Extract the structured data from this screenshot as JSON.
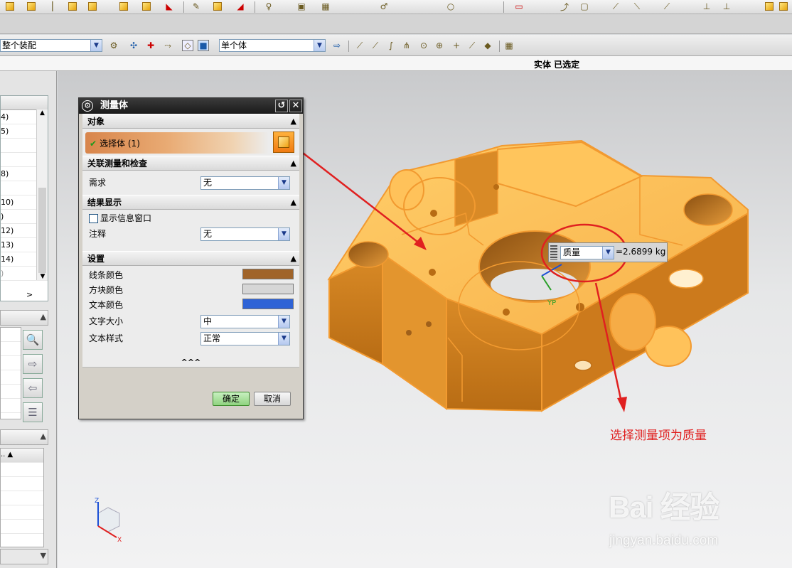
{
  "toolbar_top": {
    "icons": [
      "part-cube-icon",
      "assembly-icon",
      "cube-icon",
      "cube-group-icon",
      "cube-edit-icon",
      "cube-red-icon",
      "wrench-icon",
      "cube-small-icon",
      "cube-arrow-icon",
      "bulb-icon",
      "doc-icon",
      "view-icon",
      "snap-icon",
      "snap-circle-icon",
      "plane-icon",
      "arrow-icon",
      "image-icon",
      "line-icon",
      "line2-icon",
      "axis-icon",
      "cube-end-icon"
    ]
  },
  "toolbar_selection": {
    "filter_combo": "整个装配",
    "type_combo": "单个体"
  },
  "status": {
    "text": "实体 已选定"
  },
  "left_panel": {
    "tree_rows": [
      "4)",
      "5)",
      "",
      "",
      "8)",
      "",
      "10)",
      ")",
      "12)",
      "13)",
      "14)",
      ")"
    ],
    "scroll_right": ">"
  },
  "dialog": {
    "title": "测量体",
    "sections": {
      "object": {
        "header": "对象",
        "select_label": "选择体 (1)"
      },
      "measure": {
        "header": "关联测量和检查",
        "requirement_label": "需求",
        "requirement_value": "无"
      },
      "results": {
        "header": "结果显示",
        "show_info_label": "显示信息窗口",
        "annotation_label": "注释",
        "annotation_value": "无"
      },
      "settings": {
        "header": "设置",
        "line_color_label": "线条颜色",
        "block_color_label": "方块颜色",
        "text_color_label": "文本颜色",
        "text_size_label": "文字大小",
        "text_size_value": "中",
        "text_style_label": "文本样式",
        "text_style_value": "正常",
        "line_color": "#a0642a",
        "block_color": "#d6d6d6",
        "text_color": "#2f63d6"
      }
    },
    "more": "^^^",
    "ok": "确定",
    "cancel": "取消"
  },
  "measure_label": {
    "combo": "质量",
    "value": "=2.6899 kg"
  },
  "axis_labels": {
    "x": "X",
    "y": "Y",
    "z": "Z",
    "yp": "YP"
  },
  "annotation": "选择测量项为质量",
  "watermark": {
    "logo": "Bai 经验",
    "url": "jingyan.baidu.com"
  },
  "colors": {
    "part_fill": "#f8b550",
    "part_edge": "#f29a30",
    "arrow": "#e02020"
  }
}
